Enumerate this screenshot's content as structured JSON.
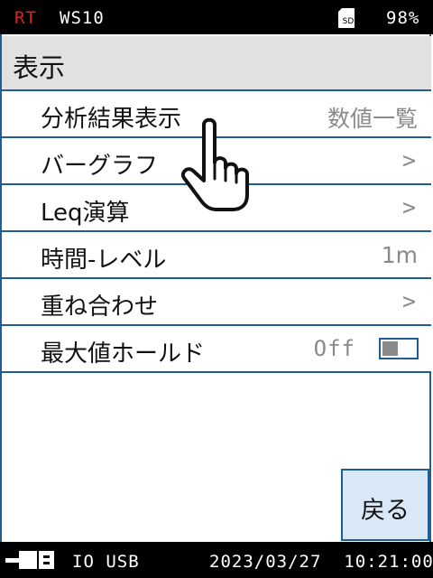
{
  "status_bar": {
    "mode": "RT",
    "weighting": "WS10",
    "sd_label": "SD",
    "battery": "98%"
  },
  "header": {
    "title": "表示"
  },
  "menu": [
    {
      "label": "分析結果表示",
      "value": "数値一覧",
      "kind": "value"
    },
    {
      "label": "バーグラフ",
      "value": ">",
      "kind": "chevron"
    },
    {
      "label": "Leq演算",
      "value": ">",
      "kind": "chevron"
    },
    {
      "label": "時間-レベル",
      "value": "1m",
      "kind": "value"
    },
    {
      "label": "重ね合わせ",
      "value": ">",
      "kind": "chevron"
    },
    {
      "label": "最大値ホールド",
      "value": "Off",
      "kind": "toggle",
      "toggle_on": false
    }
  ],
  "back_button": {
    "label": "戻る"
  },
  "bottom_bar": {
    "interface": "IO USB",
    "datetime": "2023/03/27  10:21:00"
  },
  "colors": {
    "border": "#1f5d94",
    "header_bg": "#e1e1e1",
    "button_bg": "#d8e8f6",
    "rt_red": "#e02020"
  },
  "icons": {
    "sd_card": "sd-card-icon",
    "connection": "usb-connection-icon",
    "pointer": "pointing-hand-icon"
  }
}
